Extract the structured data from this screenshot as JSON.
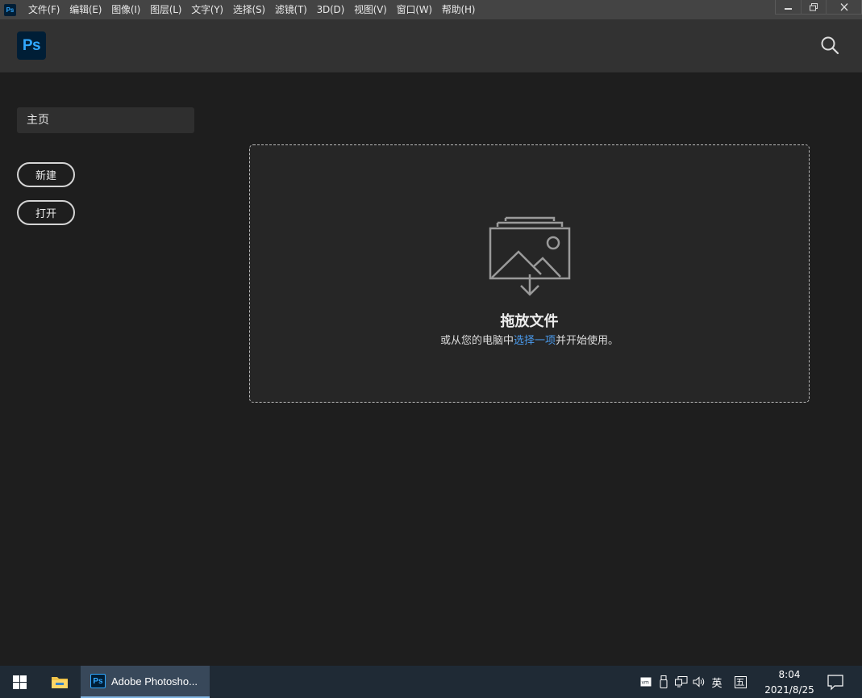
{
  "menubar": {
    "app_icon": "ps-icon",
    "logo_text": "Ps",
    "items": [
      "文件(F)",
      "编辑(E)",
      "图像(I)",
      "图层(L)",
      "文字(Y)",
      "选择(S)",
      "滤镜(T)",
      "3D(D)",
      "视图(V)",
      "窗口(W)",
      "帮助(H)"
    ]
  },
  "header": {
    "logo_text": "Ps",
    "search_icon": "search-icon"
  },
  "sidebar": {
    "home_label": "主页",
    "new_label": "新建",
    "open_label": "打开"
  },
  "dropzone": {
    "title": "拖放文件",
    "sub_before": "或从您的电脑中",
    "sub_link": "选择一项",
    "sub_after": "并开始使用。"
  },
  "taskbar": {
    "ps_label": "Adobe Photosho...",
    "ps_icon_text": "Ps",
    "ime_label": "英",
    "ime_mode": "五",
    "time": "8:04",
    "date": "2021/8/25"
  },
  "colors": {
    "background": "#1e1e1e",
    "accent_blue": "#31a8ff",
    "link_blue": "#4a9cf0",
    "ps_dark": "#001e36"
  }
}
